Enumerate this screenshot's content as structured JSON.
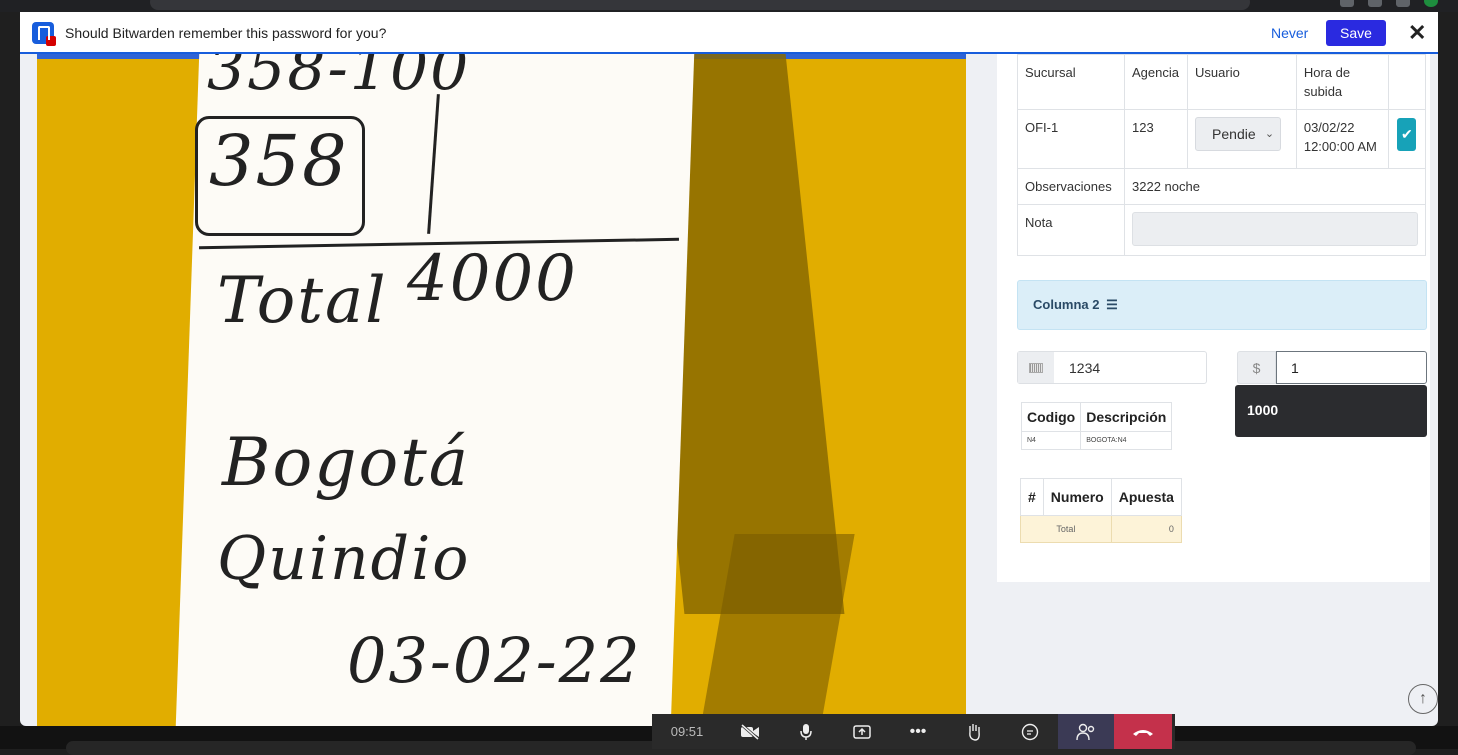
{
  "bitwarden": {
    "message": "Should Bitwarden remember this password for you?",
    "never_label": "Never",
    "save_label": "Save",
    "close_label": "✕"
  },
  "photo": {
    "handwriting": [
      "358-100",
      "358",
      "Total",
      "4000",
      "Bogotá",
      "Quindio",
      "03-02-22"
    ]
  },
  "info_table": {
    "headers": {
      "sucursal": "Sucursal",
      "agencia": "Agencia",
      "usuario": "Usuario",
      "hora": "Hora de subida"
    },
    "row": {
      "sucursal": "OFI-1",
      "agencia": "123",
      "estado": "Pendie",
      "hora": "03/02/22 12:00:00 AM"
    },
    "observaciones_label": "Observaciones",
    "observaciones_value": "3222 noche",
    "nota_label": "Nota"
  },
  "columna": {
    "title": "Columna 2",
    "icon": "list-icon"
  },
  "numero_input": {
    "value": "1234"
  },
  "apuesta_input": {
    "currency": "$",
    "value": "1",
    "suggestion": "1000"
  },
  "codes_table": {
    "headers": [
      "Codigo",
      "Descripción"
    ],
    "rows": [
      {
        "codigo": "N4",
        "descripcion": "BOGOTA:N4"
      }
    ]
  },
  "bets_table": {
    "headers": [
      "#",
      "Numero",
      "Apuesta"
    ],
    "total_label": "Total",
    "total_value": "0"
  },
  "meeting": {
    "time": "09:51",
    "buttons": [
      "camera-off",
      "mic",
      "share",
      "more",
      "raise-hand",
      "chat",
      "people",
      "hang-up"
    ]
  },
  "colors": {
    "bitwarden_blue": "#175ddc",
    "teal": "#17a2b8",
    "hangup_red": "#c4314b"
  }
}
